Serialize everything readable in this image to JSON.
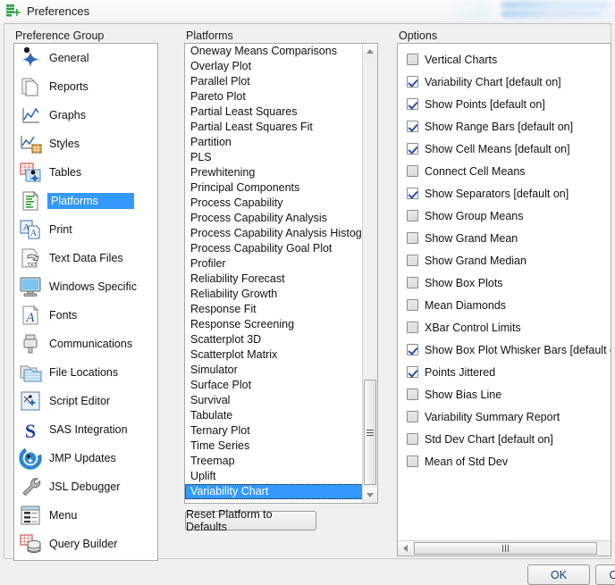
{
  "window": {
    "title": "Preferences",
    "icon": "preferences-icon"
  },
  "preference_group": {
    "label": "Preference Group",
    "selected": "Platforms",
    "items": [
      {
        "label": "General",
        "icon": "jmp-star-icon"
      },
      {
        "label": "Reports",
        "icon": "documents-icon"
      },
      {
        "label": "Graphs",
        "icon": "line-chart-icon"
      },
      {
        "label": "Styles",
        "icon": "chart-styles-icon"
      },
      {
        "label": "Tables",
        "icon": "data-table-icon"
      },
      {
        "label": "Platforms",
        "icon": "platforms-icon"
      },
      {
        "label": "Print",
        "icon": "print-icon"
      },
      {
        "label": "Text Data Files",
        "icon": "txt-file-icon"
      },
      {
        "label": "Windows Specific",
        "icon": "monitor-icon"
      },
      {
        "label": "Fonts",
        "icon": "font-icon"
      },
      {
        "label": "Communications",
        "icon": "usb-plug-icon"
      },
      {
        "label": "File Locations",
        "icon": "folders-icon"
      },
      {
        "label": "Script Editor",
        "icon": "script-editor-icon"
      },
      {
        "label": "SAS Integration",
        "icon": "sas-logo-icon"
      },
      {
        "label": "JMP Updates",
        "icon": "jmp-updates-icon"
      },
      {
        "label": "JSL Debugger",
        "icon": "wrench-icon"
      },
      {
        "label": "Menu",
        "icon": "menu-list-icon"
      },
      {
        "label": "Query Builder",
        "icon": "database-grid-icon"
      }
    ]
  },
  "platforms": {
    "label": "Platforms",
    "selected": "Variability Chart",
    "reset_button": "Reset Platform to Defaults",
    "items": [
      "Oneway Means Comparisons",
      "Overlay Plot",
      "Parallel Plot",
      "Pareto Plot",
      "Partial Least Squares",
      "Partial Least Squares Fit",
      "Partition",
      "PLS",
      "Prewhitening",
      "Principal Components",
      "Process Capability",
      "Process Capability Analysis",
      "Process Capability Analysis Histogram",
      "Process Capability Goal Plot",
      "Profiler",
      "Reliability Forecast",
      "Reliability Growth",
      "Response Fit",
      "Response Screening",
      "Scatterplot 3D",
      "Scatterplot Matrix",
      "Simulator",
      "Surface Plot",
      "Survival",
      "Tabulate",
      "Ternary Plot",
      "Time Series",
      "Treemap",
      "Uplift",
      "Variability Chart"
    ]
  },
  "options": {
    "label": "Options",
    "items": [
      {
        "label": "Vertical Charts",
        "checked": false
      },
      {
        "label": "Variability Chart [default on]",
        "checked": true
      },
      {
        "label": "Show Points [default on]",
        "checked": true
      },
      {
        "label": "Show Range Bars [default on]",
        "checked": true
      },
      {
        "label": "Show Cell Means [default on]",
        "checked": true
      },
      {
        "label": "Connect Cell Means",
        "checked": false
      },
      {
        "label": "Show Separators [default on]",
        "checked": true
      },
      {
        "label": "Show Group Means",
        "checked": false
      },
      {
        "label": "Show Grand Mean",
        "checked": false
      },
      {
        "label": "Show Grand Median",
        "checked": false
      },
      {
        "label": "Show Box Plots",
        "checked": false
      },
      {
        "label": "Mean Diamonds",
        "checked": false
      },
      {
        "label": "XBar Control Limits",
        "checked": false
      },
      {
        "label": "Show Box Plot Whisker Bars [default on]",
        "checked": true
      },
      {
        "label": "Points Jittered",
        "checked": true
      },
      {
        "label": "Show Bias Line",
        "checked": false
      },
      {
        "label": "Variability Summary Report",
        "checked": false
      },
      {
        "label": "Std Dev Chart [default on]",
        "checked": false
      },
      {
        "label": "Mean of Std Dev",
        "checked": false
      }
    ]
  },
  "dialog_buttons": {
    "ok": "OK",
    "cancel": "Cancel"
  },
  "colors": {
    "selection_blue": "#3399ff",
    "checkmark_blue": "#2a4fa8",
    "window_bg": "#f0f0f0",
    "panel_bg": "#ffffff"
  }
}
